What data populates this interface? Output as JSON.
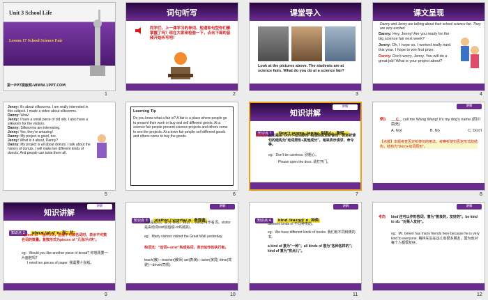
{
  "slides": [
    {
      "num": "1",
      "title": "Unit 3 School Life",
      "lesson": "Lesson 17 School Science Fair",
      "footer": "第一PPT模板网-WWW.1PPT.COM"
    },
    {
      "num": "2",
      "title": "词句听写",
      "body": "同学们，上一课学习的单词、短语和句型你们都掌握了吗？现在大家来检验一下，点击下面的音频开始听写吧！"
    },
    {
      "num": "3",
      "title": "课堂导入",
      "body": "Look at the pictures above. The students are at science fairs. What do you do at a science fair?"
    },
    {
      "num": "4",
      "title": "课文呈现",
      "intro": "Danny and Jenny are talking about their school science fair. They are very excited.",
      "lines": [
        {
          "speaker": "Danny:",
          "text": "Hey, Jenny! Are you ready for the big science fair next week?"
        },
        {
          "speaker": "Jenny:",
          "text": "Oh, I hope so. I worked really hard this year. I hope to win first prize."
        },
        {
          "speaker": "Danny:",
          "text": "Don't worry, Jenny. You will do a great job! What is your project about?"
        }
      ]
    },
    {
      "num": "5",
      "lines": [
        {
          "speaker": "Jenny:",
          "text": "It's about silkworms. I am really interested in this subject. I made a video about silkworms."
        },
        {
          "speaker": "Danny:",
          "text": "Wow!"
        },
        {
          "speaker": "Jenny:",
          "text": "I have a small piece of old silk. I also have a silkworm for the visitors."
        },
        {
          "speaker": "Danny:",
          "text": "Silkworms are interesting."
        },
        {
          "speaker": "Jenny:",
          "text": "Yes, they're amazing!"
        },
        {
          "speaker": "Danny:",
          "text": "My project is good, too."
        },
        {
          "speaker": "Jenny:",
          "text": "What is it about, Danny?"
        },
        {
          "speaker": "Danny:",
          "text": "My project is all about donuts. I talk about the history of donuts. I will make ten different kinds of donuts. And people can taste them all."
        }
      ]
    },
    {
      "num": "6",
      "heading": "Learning Tip",
      "body": "Do you know what a fair is? A fair is a place where people go to present their work or buy and sell different goods. At a science fair people present science projects and others come to see the projects. At a town fair people sell different goods and others come to buy the goods."
    },
    {
      "num": "7",
      "title": "知识讲解",
      "point": "知识点 1",
      "phrase": "Don't worry, Jenny. 别担心，詹妮。",
      "tag": "知识点",
      "note": "此句是由\"Don't+动词原形\"构成的否定祈使句：否定祈使句的结构为\"动词原形+其他成分\"，用来表示请求、命令等。",
      "eg": "eg：Don't be careless. 别粗心。",
      "eg2": "Please open the door. 请打开门。"
    },
    {
      "num": "8",
      "label": "例1",
      "question": "_____ call me Wang Wang! It's my dog's name.(四川南充)",
      "options": [
        "A. Not",
        "B. No",
        "C. Don't"
      ],
      "answer": "C",
      "analysis": "【点拨】本题考查否定祈使句的用法。考察祈使句否定形式的结构，结构为\"Don't+动词原形\"。"
    },
    {
      "num": "9",
      "title": "知识讲解",
      "point": "知识点 2",
      "phrase": "piece /piːs/ n. 张；片",
      "note": "a piece of 一张/片/块，后接不可数名词时，表示不可数名词的数量。复数形式为pieces of \"几张/片/块\"。",
      "eg": "eg：Would you like another piece of bread? 你想再要一片面包吗？",
      "eg2": "I need ten pieces of paper. 我需要十张纸。"
    },
    {
      "num": "10",
      "point": "知识点 3",
      "phrase": "visitor /ˈvɪzɪtə/ n. 参观者",
      "note": "visit是动词，意为\"参观、拜访\"，visit还可作名词。visitor是由动词visit加后缀-or构成的。",
      "eg": "eg：Many visitors visited the Great Wall yesterday.",
      "note2": "构词法：\"动词+-or/er\"构成名词，表示动作的执行者。",
      "eg2": "teach(教)—teacher(教师)  act(表演)—actor(演员)  drive(驾驶)—driver(司机)"
    },
    {
      "num": "11",
      "point": "知识点 4",
      "phrase": "kind /kaɪnd/ n. 种类",
      "note": "different kinds of 不同种类的。",
      "eg": "eg：We have different kinds of books. 我们有不同种类的书。",
      "note2": "a kind of 意为\"一种\"；all kinds of 意为\"各种各样的\"；kind of 意为\"有点儿\"。"
    },
    {
      "num": "12",
      "label": "考向",
      "note": "kind 还可以作形容词，意为\"善良的，友好的\"。be kind to sb. \"对某人友好\"。",
      "eg": "eg：Mr. Green has many friends here because he is very kind to everyone. 格林先生在这儿有很多朋友，因为他对每个人都很友好。"
    }
  ],
  "colors": {
    "purple": "#6a2d8f",
    "highlight": "#e8a11a",
    "red": "#d21b1b",
    "yellow": "#f2e02a"
  }
}
